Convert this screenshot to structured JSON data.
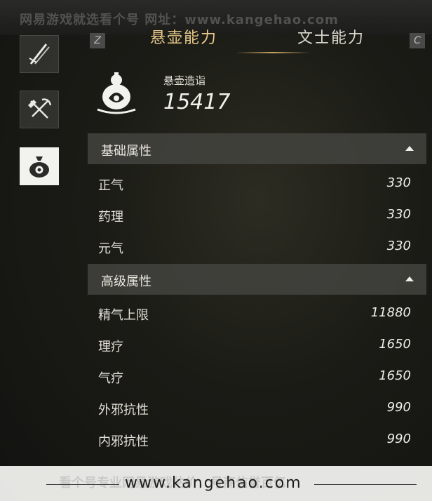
{
  "watermark": {
    "top_text": "网易游戏就选看个号  网址：www.kangehao.com"
  },
  "tabs": {
    "left_key": "Z",
    "right_key": "C",
    "items": [
      {
        "label": "悬壶能力",
        "active": true
      },
      {
        "label": "文士能力",
        "active": false
      }
    ]
  },
  "sidebar": {
    "icons": [
      "sword-icon",
      "shovel-pickaxe-icon",
      "medicine-bag-icon"
    ],
    "active_index": 2
  },
  "score": {
    "label": "悬壶造诣",
    "value": "15417",
    "icon": "gourd-icon"
  },
  "sections": [
    {
      "title": "基础属性",
      "rows": [
        {
          "label": "正气",
          "value": "330"
        },
        {
          "label": "药理",
          "value": "330"
        },
        {
          "label": "元气",
          "value": "330"
        }
      ]
    },
    {
      "title": "高级属性",
      "rows": [
        {
          "label": "精气上限",
          "value": "11880"
        },
        {
          "label": "理疗",
          "value": "1650"
        },
        {
          "label": "气疗",
          "value": "1650"
        },
        {
          "label": "外邪抗性",
          "value": "990"
        },
        {
          "label": "内邪抗性",
          "value": "990"
        }
      ]
    }
  ],
  "footer": {
    "faded_text": "看个号专业网易游戏估价，号商信誉百亿",
    "url": "www.kangehao.com"
  },
  "colors": {
    "accent_gold": "#e9c98a",
    "panel": "#46463f",
    "footer_bg": "#f0f0ee"
  }
}
